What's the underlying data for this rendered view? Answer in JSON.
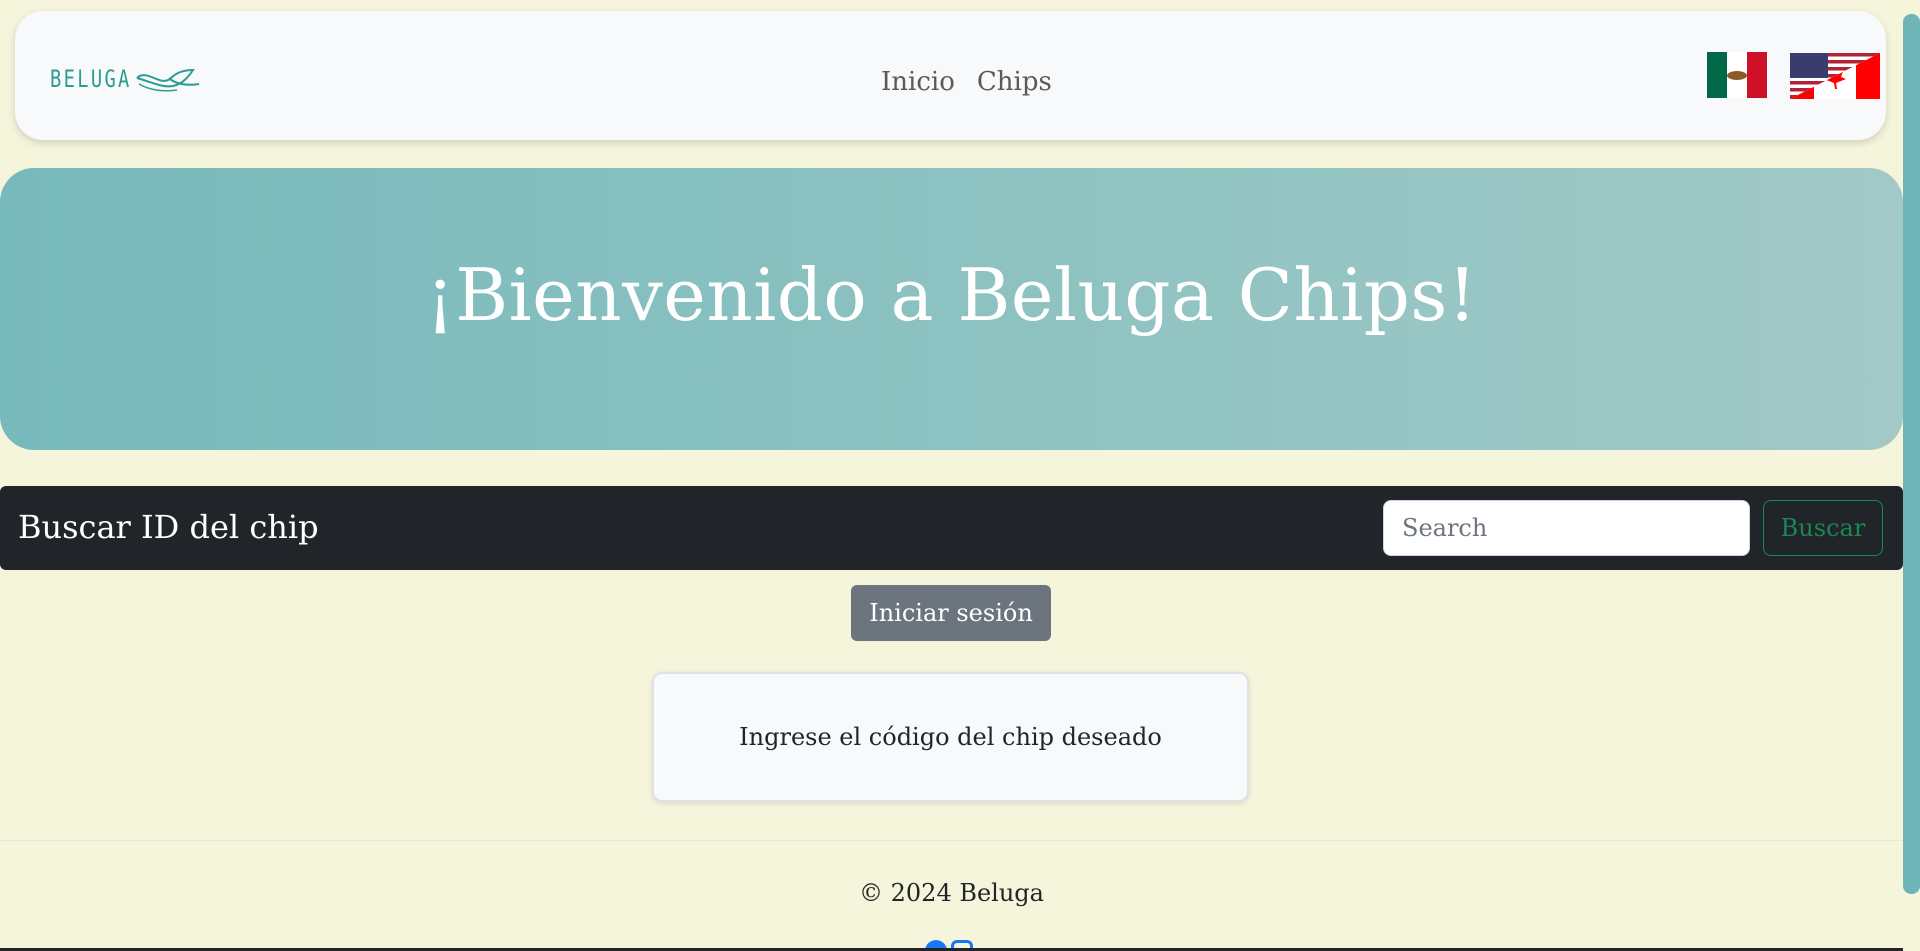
{
  "navbar": {
    "logo_text": "BELUGA",
    "links": [
      {
        "label": "Inicio"
      },
      {
        "label": "Chips"
      }
    ],
    "flags": [
      "mexico-flag-icon",
      "usa-canada-flag-icon"
    ]
  },
  "hero": {
    "title": "¡Bienvenido a Beluga Chips!"
  },
  "search": {
    "title": "Buscar ID del chip",
    "placeholder": "Search",
    "button_label": "Buscar"
  },
  "login": {
    "button_label": "Iniciar sesión"
  },
  "info_card": {
    "text": "Ingrese el código del chip deseado"
  },
  "footer": {
    "copyright": "© 2024 Beluga",
    "social_icons": [
      "facebook-icon",
      "instagram-icon"
    ]
  },
  "colors": {
    "background": "#f5f5dc",
    "accent": "#78b9bb",
    "dark": "#212529",
    "success": "#198754",
    "secondary": "#6c757d"
  }
}
